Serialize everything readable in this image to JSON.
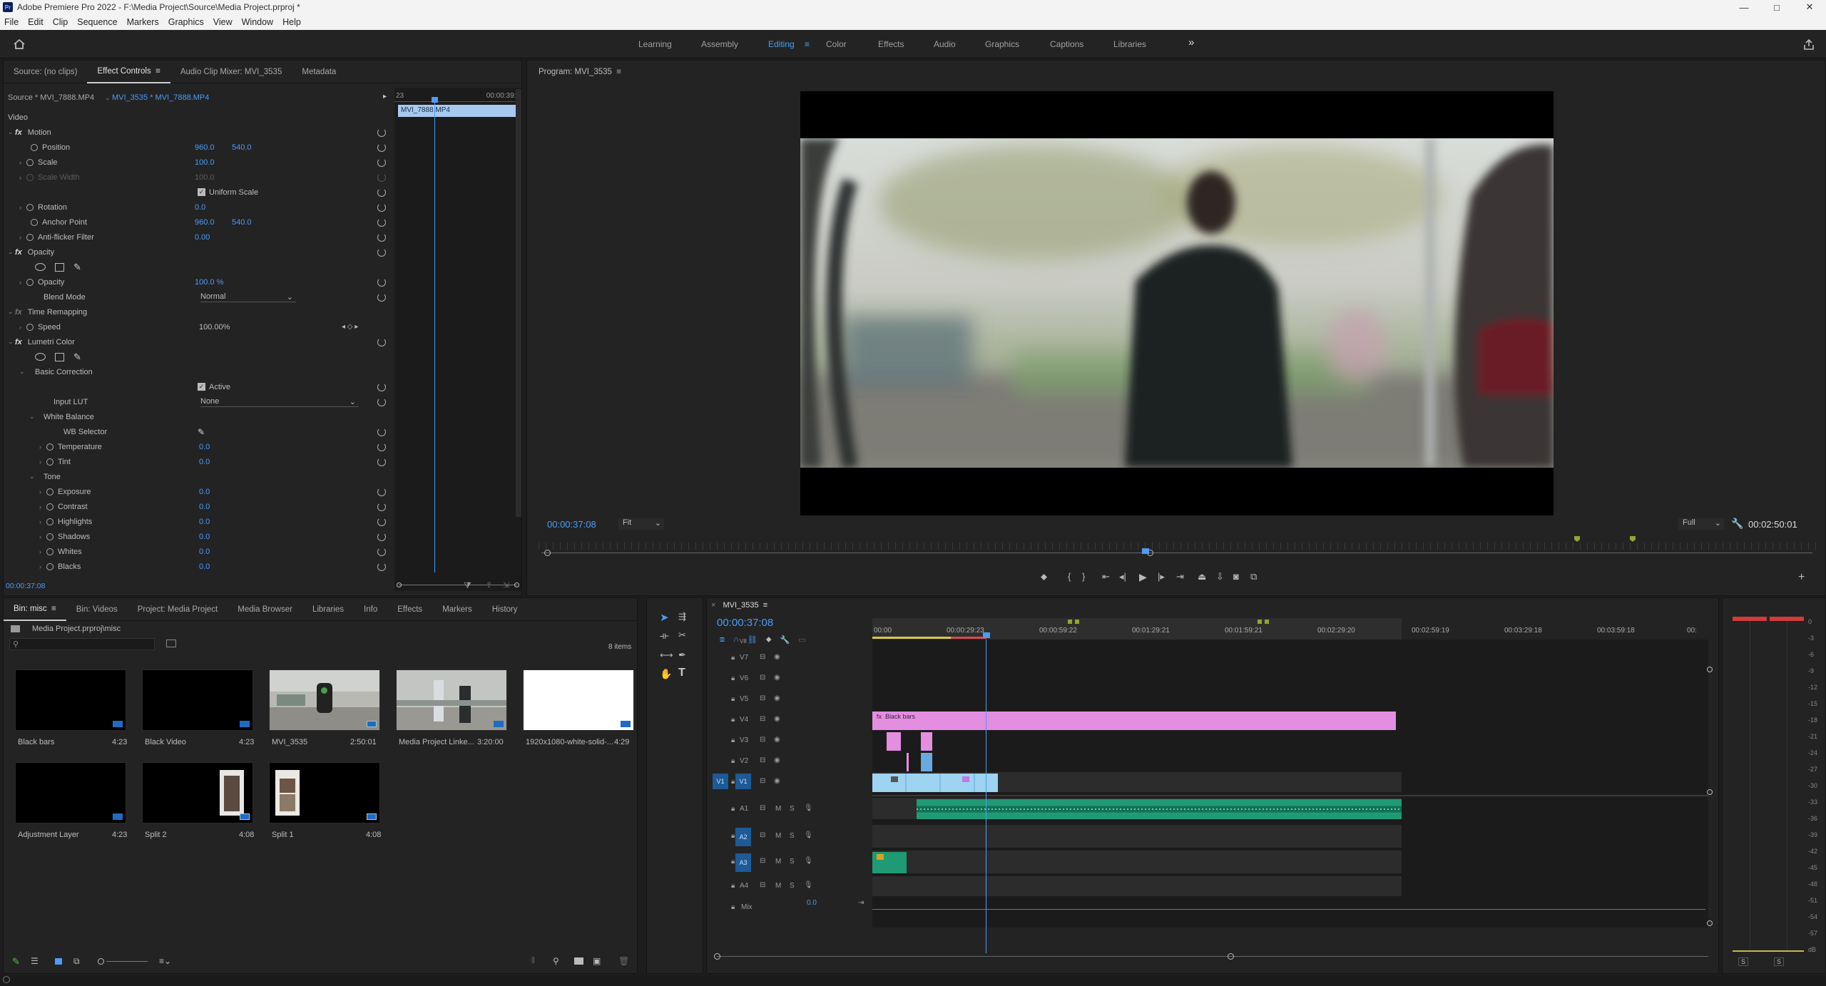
{
  "title_bar": {
    "app_icon": "Pr",
    "title": "Adobe Premiere Pro 2022 - F:\\Media Project\\Source\\Media Project.prproj *",
    "minimize": "—",
    "maximize": "□",
    "close": "✕"
  },
  "menu": [
    "File",
    "Edit",
    "Clip",
    "Sequence",
    "Markers",
    "Graphics",
    "View",
    "Window",
    "Help"
  ],
  "workspaces": {
    "items": [
      "Learning",
      "Assembly",
      "Editing",
      "Color",
      "Effects",
      "Audio",
      "Graphics",
      "Captions",
      "Libraries"
    ],
    "active": "Editing",
    "more": "»"
  },
  "source_panel": {
    "tabs": [
      "Source: (no clips)",
      "Effect Controls",
      "Audio Clip Mixer: MVI_3535",
      "Metadata"
    ],
    "active_tab": "Effect Controls",
    "source_label": "Source * MVI_7888.MP4",
    "sequence_clip": "MVI_3535 * MVI_7888.MP4",
    "mini_timeline": {
      "start": "23",
      "end": "00:00:39:2",
      "clip_name": "MVI_7888.MP4"
    },
    "section_video": "Video",
    "motion": {
      "label": "Motion",
      "position": {
        "label": "Position",
        "x": "960.0",
        "y": "540.0"
      },
      "scale": {
        "label": "Scale",
        "value": "100.0"
      },
      "scale_width": {
        "label": "Scale Width",
        "value": "100.0"
      },
      "uniform_scale": "Uniform Scale",
      "rotation": {
        "label": "Rotation",
        "value": "0.0"
      },
      "anchor_point": {
        "label": "Anchor Point",
        "x": "960.0",
        "y": "540.0"
      },
      "anti_flicker": {
        "label": "Anti-flicker Filter",
        "value": "0.00"
      }
    },
    "opacity": {
      "label": "Opacity",
      "prop": "Opacity",
      "value": "100.0 %",
      "blend_label": "Blend Mode",
      "blend_value": "Normal"
    },
    "time_remap": {
      "label": "Time Remapping",
      "speed_label": "Speed",
      "speed_value": "100.00%"
    },
    "lumetri": {
      "label": "Lumetri Color",
      "basic": "Basic Correction",
      "active": "Active",
      "input_lut_label": "Input LUT",
      "input_lut_value": "None",
      "white_balance": "White Balance",
      "wb_selector": "WB Selector",
      "temperature": {
        "label": "Temperature",
        "value": "0.0"
      },
      "tint": {
        "label": "Tint",
        "value": "0.0"
      },
      "tone": "Tone",
      "exposure": {
        "label": "Exposure",
        "value": "0.0"
      },
      "contrast": {
        "label": "Contrast",
        "value": "0.0"
      },
      "highlights": {
        "label": "Highlights",
        "value": "0.0"
      },
      "shadows": {
        "label": "Shadows",
        "value": "0.0"
      },
      "whites": {
        "label": "Whites",
        "value": "0.0"
      },
      "blacks": {
        "label": "Blacks",
        "value": "0.0"
      }
    },
    "timecode": "00:00:37:08"
  },
  "program_monitor": {
    "title": "Program: MVI_3535",
    "timecode": "00:00:37:08",
    "fit": "Fit",
    "quality": "Full",
    "duration": "00:02:50:01"
  },
  "project_panel": {
    "tabs": [
      "Bin: misc",
      "Bin: Videos",
      "Project: Media Project",
      "Media Browser",
      "Libraries",
      "Info",
      "Effects",
      "Markers",
      "History"
    ],
    "active_tab": "Bin: misc",
    "path": "Media Project.prproj\\misc",
    "item_count": "8 items",
    "items": [
      {
        "name": "Black bars",
        "duration": "4:23"
      },
      {
        "name": "Black Video",
        "duration": "4:23"
      },
      {
        "name": "MVI_3535",
        "duration": "2:50:01"
      },
      {
        "name": "Media Project Linke...",
        "duration": "3:20:00"
      },
      {
        "name": "1920x1080-white-solid-...",
        "duration": "4:29"
      },
      {
        "name": "Adjustment Layer",
        "duration": "4:23"
      },
      {
        "name": "Split 2",
        "duration": "4:08"
      },
      {
        "name": "Split 1",
        "duration": "4:08"
      }
    ]
  },
  "timeline": {
    "sequence_name": "MVI_3535",
    "timecode": "00:00:37:08",
    "ruler": [
      "00:00",
      "00:00:29:23",
      "00:00:59:22",
      "00:01:29:21",
      "00:01:59:21",
      "00:02:29:20",
      "00:02:59:19",
      "00:03:29:18",
      "00:03:59:18",
      "00:"
    ],
    "video_tracks": [
      "V8",
      "V7",
      "V6",
      "V5",
      "V4",
      "V3",
      "V2",
      "V1"
    ],
    "audio_tracks": [
      "A1",
      "A2",
      "A3",
      "A4"
    ],
    "source_patch_video": "V1",
    "source_patch_audio": "A2",
    "black_bars_clip": "Black bars",
    "fx_badge": "fx",
    "mute": "M",
    "solo": "S",
    "mix_label": "Mix",
    "mix_value": "0.0"
  },
  "audio_meter": {
    "scale": [
      "0",
      "-3",
      "-6",
      "-9",
      "-12",
      "-15",
      "-18",
      "-21",
      "-24",
      "-27",
      "-30",
      "-33",
      "-36",
      "-39",
      "-42",
      "-45",
      "-48",
      "-51",
      "-54",
      "-57",
      "dB"
    ],
    "solo_left": "S",
    "solo_right": "S"
  },
  "colors": {
    "accent": "#4b9cf5",
    "video_clip": "#9fd3f2",
    "pink_clip": "#e38ee0",
    "audio_clip": "#1f9a74"
  }
}
